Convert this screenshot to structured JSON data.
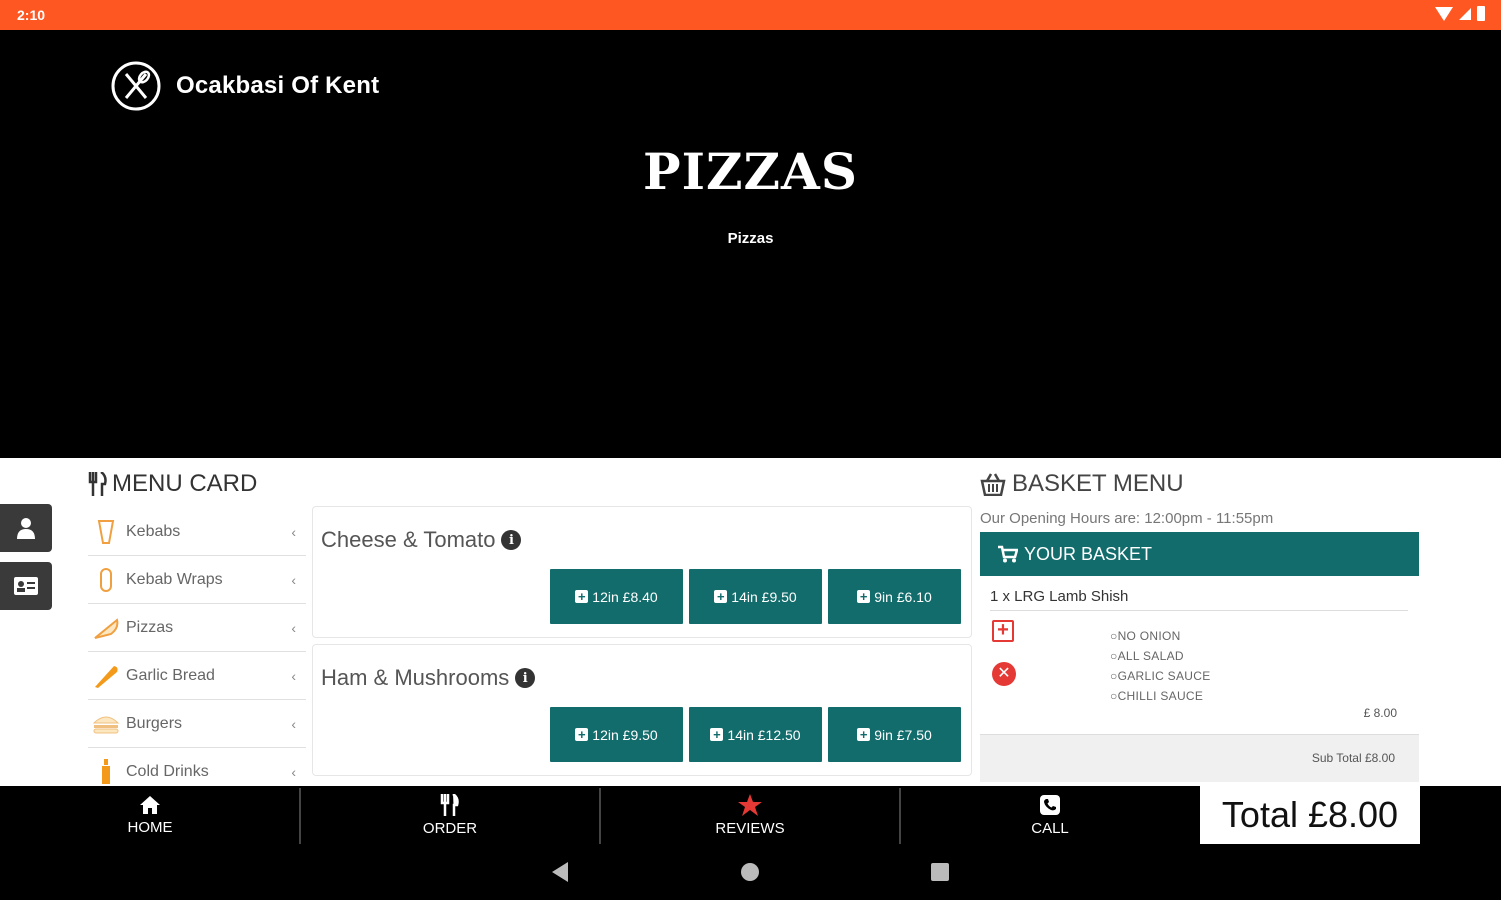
{
  "status_bar": {
    "time": "2:10"
  },
  "header": {
    "brand_name": "Ocakbasi Of Kent",
    "title": "PIZZAS",
    "subtitle": "Pizzas"
  },
  "menu_card": {
    "heading": "MENU CARD",
    "categories": [
      {
        "label": "Kebabs",
        "icon": "kebab-icon"
      },
      {
        "label": "Kebab Wraps",
        "icon": "wrap-icon"
      },
      {
        "label": "Pizzas",
        "icon": "pizza-icon"
      },
      {
        "label": "Garlic Bread",
        "icon": "bread-icon"
      },
      {
        "label": "Burgers",
        "icon": "burger-icon"
      },
      {
        "label": "Cold Drinks",
        "icon": "drink-icon"
      }
    ]
  },
  "products": [
    {
      "name": "Cheese & Tomato",
      "prices": [
        "12in £8.40",
        "14in £9.50",
        "9in £6.10"
      ]
    },
    {
      "name": "Ham & Mushrooms",
      "prices": [
        "12in £9.50",
        "14in £12.50",
        "9in £7.50"
      ]
    }
  ],
  "basket": {
    "heading": "BASKET MENU",
    "opening_hours": "Our Opening Hours are: 12:00pm - 11:55pm",
    "bar_label": "YOUR BASKET",
    "item": "1 x LRG Lamb Shish",
    "options": [
      "NO ONION",
      "ALL SALAD",
      "GARLIC SAUCE",
      "CHILLI SAUCE"
    ],
    "item_price": "£ 8.00",
    "sub_total": "Sub Total £8.00"
  },
  "bottom_nav": {
    "home": "HOME",
    "order": "ORDER",
    "reviews": "REVIEWS",
    "call": "CALL",
    "total": "Total £8.00"
  },
  "colors": {
    "accent": "#ff5722",
    "teal": "#136c6c",
    "delete": "#e53935",
    "star": "#e53935"
  }
}
